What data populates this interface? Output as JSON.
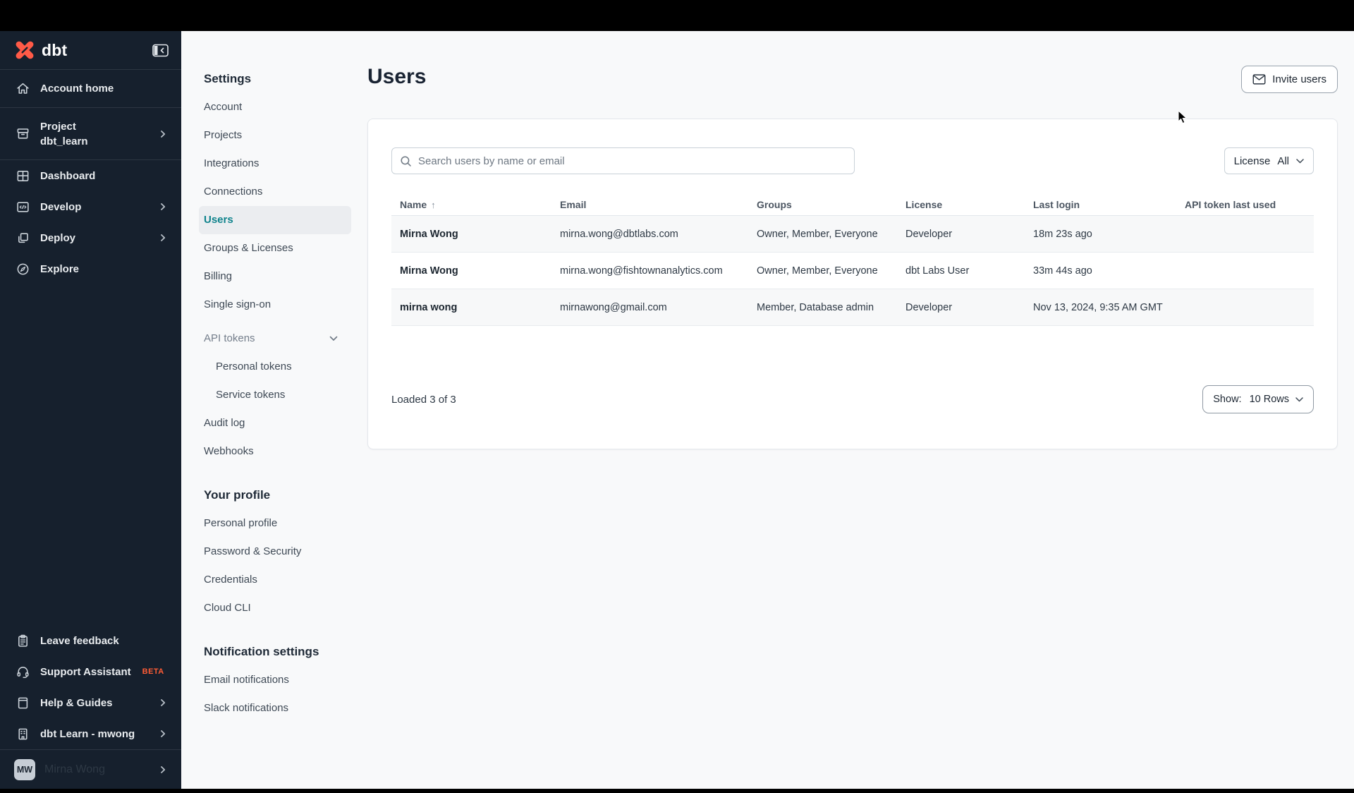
{
  "sidebar": {
    "logo_text": "dbt",
    "nav": [
      {
        "label": "Account home"
      },
      {
        "label": "Project",
        "sublabel": "dbt_learn"
      },
      {
        "label": "Dashboard"
      },
      {
        "label": "Develop"
      },
      {
        "label": "Deploy"
      },
      {
        "label": "Explore"
      }
    ],
    "footer_nav": [
      {
        "label": "Leave feedback"
      },
      {
        "label": "Support Assistant",
        "badge": "BETA"
      },
      {
        "label": "Help & Guides"
      },
      {
        "label": "dbt Learn - mwong"
      }
    ],
    "user": {
      "initials": "MW",
      "name": "Mirna Wong"
    }
  },
  "settings_nav": {
    "heading_settings": "Settings",
    "items": [
      "Account",
      "Projects",
      "Integrations",
      "Connections",
      "Users",
      "Groups & Licenses",
      "Billing",
      "Single sign-on"
    ],
    "api_tokens": "API tokens",
    "token_items": [
      "Personal tokens",
      "Service tokens"
    ],
    "items_b": [
      "Audit log",
      "Webhooks"
    ],
    "heading_profile": "Your profile",
    "profile_items": [
      "Personal profile",
      "Password & Security",
      "Credentials",
      "Cloud CLI"
    ],
    "heading_notifications": "Notification settings",
    "notification_items": [
      "Email notifications",
      "Slack notifications"
    ]
  },
  "main": {
    "title": "Users",
    "invite_button_label": "Invite users",
    "search_placeholder": "Search users by name or email",
    "license_filter": {
      "label": "License",
      "value": "All"
    },
    "table": {
      "columns": [
        "Name",
        "Email",
        "Groups",
        "License",
        "Last login",
        "API token last used"
      ],
      "rows": [
        {
          "name": "Mirna Wong",
          "email": "mirna.wong@dbtlabs.com",
          "groups": "Owner, Member, Everyone",
          "license": "Developer",
          "last_login": "18m 23s ago",
          "api_token_last_used": ""
        },
        {
          "name": "Mirna Wong",
          "email": "mirna.wong@fishtownanalytics.com",
          "groups": "Owner, Member, Everyone",
          "license": "dbt Labs User",
          "last_login": "33m 44s ago",
          "api_token_last_used": ""
        },
        {
          "name": "mirna wong",
          "email": "mirnawong@gmail.com",
          "groups": "Member, Database admin",
          "license": "Developer",
          "last_login": "Nov 13, 2024, 9:35 AM GMT",
          "api_token_last_used": ""
        }
      ]
    },
    "footer": {
      "loaded_text": "Loaded 3 of 3",
      "show_label": "Show:",
      "show_value": "10 Rows"
    }
  },
  "colors": {
    "accent_orange": "#FF5C35",
    "active_teal": "#0F838C",
    "sidebar_bg": "#16202D"
  }
}
